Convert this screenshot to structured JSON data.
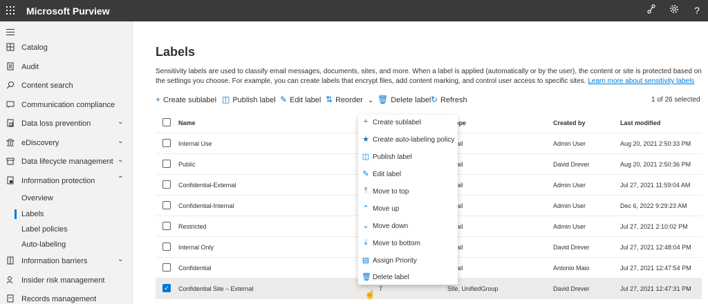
{
  "app": {
    "title": "Microsoft Purview"
  },
  "topbar_icons": [
    "share-icon",
    "gear-icon",
    "help-icon"
  ],
  "topbar_help_glyph": "?",
  "sidebar": {
    "items": [
      {
        "label": "Catalog",
        "icon": "catalog-icon"
      },
      {
        "label": "Audit",
        "icon": "audit-icon"
      },
      {
        "label": "Content search",
        "icon": "search-icon"
      },
      {
        "label": "Communication compliance",
        "icon": "chat-icon"
      },
      {
        "label": "Data loss prevention",
        "icon": "shield-doc-icon"
      },
      {
        "label": "eDiscovery",
        "icon": "building-icon"
      },
      {
        "label": "Data lifecycle management",
        "icon": "archive-icon"
      },
      {
        "label": "Information protection",
        "icon": "doc-lock-icon"
      }
    ],
    "sub_items": [
      {
        "label": "Overview"
      },
      {
        "label": "Labels",
        "active": true
      },
      {
        "label": "Label policies"
      },
      {
        "label": "Auto-labeling"
      }
    ],
    "lower_items": [
      {
        "label": "Information barriers",
        "icon": "barrier-icon"
      },
      {
        "label": "Insider risk management",
        "icon": "person-icon"
      },
      {
        "label": "Records management",
        "icon": "records-icon"
      }
    ]
  },
  "page": {
    "title": "Labels",
    "description": "Sensitivity labels are used to classify email messages, documents, sites, and more. When a label is applied (automatically or by the user), the content or site is protected based on the settings you choose. For example, you can create labels that encrypt files, add content marking, and control user access to specific sites.",
    "learn_more": "Learn more about sensitivity labels"
  },
  "toolbar": {
    "create_sublabel": "Create sublabel",
    "publish_label": "Publish label",
    "edit_label": "Edit label",
    "reorder": "Reorder",
    "delete_label": "Delete label",
    "refresh": "Refresh",
    "selection_count": "1 of 26 selected"
  },
  "table": {
    "headers": {
      "name": "Name",
      "scope": "Scope",
      "created_by": "Created by",
      "last_modified": "Last modified"
    },
    "rows": [
      {
        "name": "Internal Use",
        "scope": "Email",
        "created_by": "Admin User",
        "last_modified": "Aug 20, 2021 2:50:33 PM"
      },
      {
        "name": "Public",
        "scope": "Email",
        "created_by": "David Drever",
        "last_modified": "Aug 20, 2021 2:50:36 PM"
      },
      {
        "name": "Confidential-External",
        "scope": "Email",
        "created_by": "Admin User",
        "last_modified": "Jul 27, 2021 11:59:04 AM"
      },
      {
        "name": "Confidential-Internal",
        "scope": "Email",
        "created_by": "Admin User",
        "last_modified": "Dec 6, 2022 9:29:23 AM"
      },
      {
        "name": "Restricted",
        "scope": "Email",
        "created_by": "Admin User",
        "last_modified": "Jul 27, 2021 2:10:02 PM"
      },
      {
        "name": "Internal Only",
        "scope": "Email",
        "created_by": "David Drever",
        "last_modified": "Jul 27, 2021 12:48:04 PM"
      },
      {
        "name": "Confidential",
        "scope": "Email",
        "created_by": "Antonio Maio",
        "last_modified": "Jul 27, 2021 12:47:54 PM"
      },
      {
        "name": "Confidential Site – External",
        "priority": "7",
        "scope": "Site, UnifiedGroup",
        "created_by": "David Drever",
        "last_modified": "Jul 27, 2021 12:47:31 PM",
        "selected": true
      }
    ]
  },
  "context_menu": {
    "items": [
      {
        "label": "Create sublabel",
        "icon": "plus-icon"
      },
      {
        "label": "Create auto-labeling policy",
        "icon": "auto-label-icon"
      },
      {
        "label": "Publish label",
        "icon": "publish-icon"
      },
      {
        "label": "Edit label",
        "icon": "pencil-icon"
      },
      {
        "label": "Move to top",
        "icon": "move-top-icon"
      },
      {
        "label": "Move up",
        "icon": "chevron-up-icon"
      },
      {
        "label": "Move down",
        "icon": "chevron-down-icon"
      },
      {
        "label": "Move to bottom",
        "icon": "move-bottom-icon"
      },
      {
        "label": "Assign Priority",
        "icon": "priority-icon"
      },
      {
        "label": "Delete label",
        "icon": "trash-icon"
      }
    ]
  },
  "colors": {
    "accent": "#0078d4",
    "topbar": "#3b3a39",
    "sidebar": "#f3f2f1"
  }
}
